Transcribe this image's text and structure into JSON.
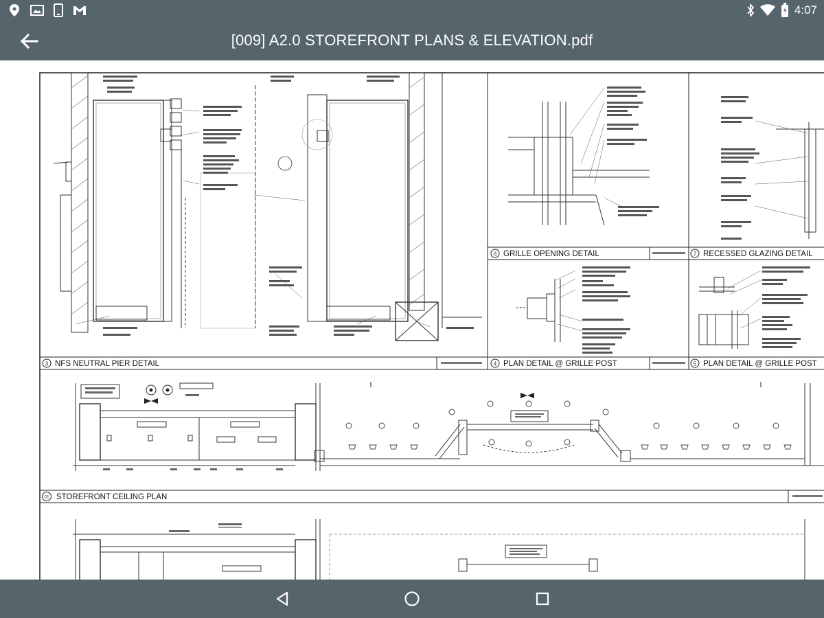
{
  "status_bar": {
    "time": "4:07",
    "left_icons": [
      "location-icon",
      "image-icon",
      "phone-icon",
      "gmail-icon"
    ],
    "right_icons": [
      "bluetooth-icon",
      "wifi-icon",
      "battery-icon"
    ]
  },
  "app_bar": {
    "title": "[009] A2.0 STOREFRONT PLANS & ELEVATION.pdf",
    "back_icon": "arrow-back-icon"
  },
  "drawing": {
    "detail_labels": {
      "neutral_pier": "NFS NEUTRAL PIER DETAIL",
      "grille_opening": "GRILLE OPENING DETAIL",
      "recessed_glazing": "RECESSED GLAZING DETAIL",
      "plan_detail_grille_post_4": "PLAN DETAIL @ GRILLE POST",
      "plan_detail_grille_post_5": "PLAN DETAIL @ GRILLE POST",
      "ceiling_plan": "STOREFRONT CEILING PLAN"
    },
    "detail_numbers": {
      "neutral_pier": "3",
      "grille_opening": "6",
      "recessed_glazing": "7",
      "plan_detail_grille_post_4": "4",
      "plan_detail_grille_post_5": "5",
      "ceiling_plan": "01"
    }
  },
  "nav_bar": {
    "icons": [
      "back-triangle-icon",
      "home-circle-icon",
      "recents-square-icon"
    ]
  },
  "colors": {
    "bars": "#56656c",
    "page": "#ffffff",
    "ink": "#222222"
  }
}
